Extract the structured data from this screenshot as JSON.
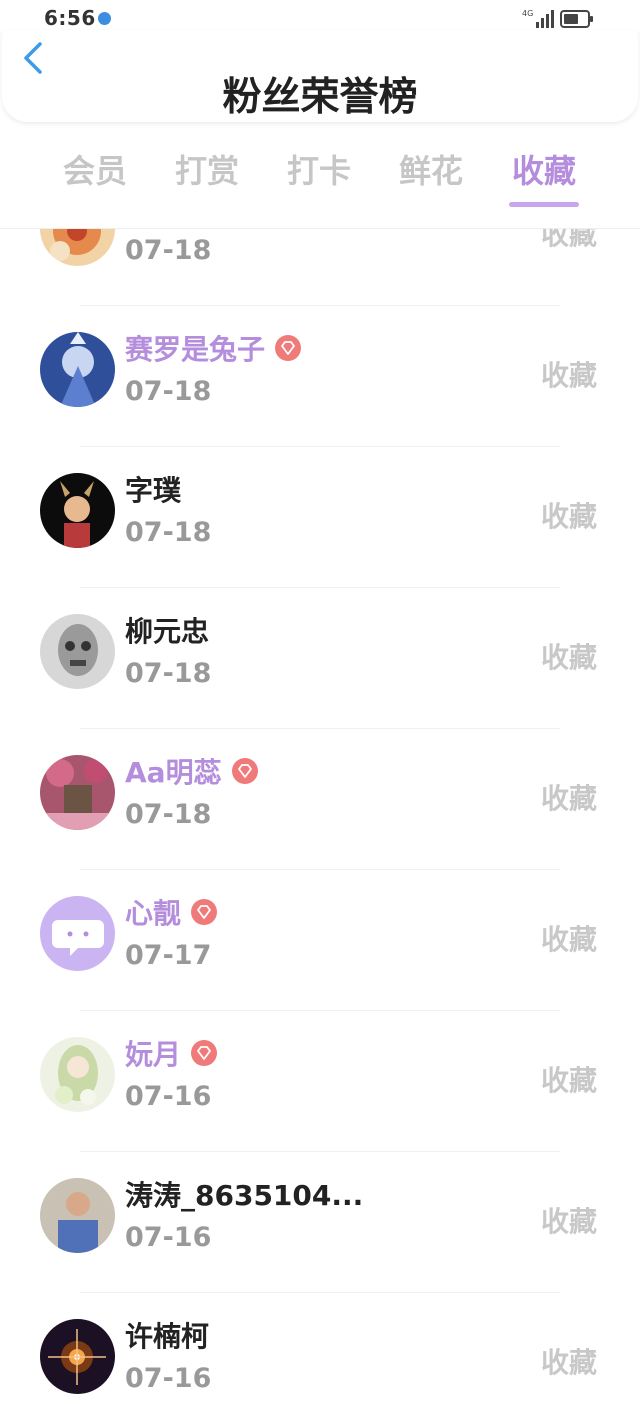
{
  "status_bar": {
    "time": "6:56",
    "network": "4G"
  },
  "header": {
    "title": "粉丝荣誉榜"
  },
  "tabs": [
    {
      "label": "会员"
    },
    {
      "label": "打赏"
    },
    {
      "label": "打卡"
    },
    {
      "label": "鲜花"
    },
    {
      "label": "收藏"
    }
  ],
  "active_tab": "收藏",
  "colors": {
    "accent": "#b48ddc",
    "vip_badge": "#f07a7a",
    "muted": "#c8c8c8"
  },
  "rows": [
    {
      "name": "",
      "vip": false,
      "date": "07-18",
      "action": "收藏"
    },
    {
      "name": "赛罗是兔子",
      "vip": true,
      "date": "07-18",
      "action": "收藏"
    },
    {
      "name": "字璞",
      "vip": false,
      "date": "07-18",
      "action": "收藏"
    },
    {
      "name": "柳元忠",
      "vip": false,
      "date": "07-18",
      "action": "收藏"
    },
    {
      "name": "Aa明蕊",
      "vip": true,
      "date": "07-18",
      "action": "收藏"
    },
    {
      "name": "心靓",
      "vip": true,
      "date": "07-17",
      "action": "收藏"
    },
    {
      "name": "妧月",
      "vip": true,
      "date": "07-16",
      "action": "收藏"
    },
    {
      "name": "涛涛_8635104...",
      "vip": false,
      "date": "07-16",
      "action": "收藏"
    },
    {
      "name": "许楠柯",
      "vip": false,
      "date": "07-16",
      "action": "收藏"
    }
  ]
}
